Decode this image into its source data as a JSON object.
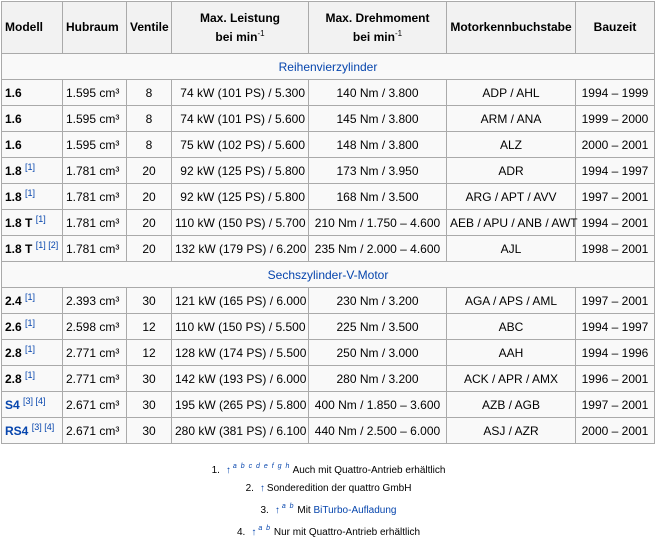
{
  "headers": {
    "modell": "Modell",
    "hubraum": "Hubraum",
    "ventile": "Ventile",
    "leistung_l1": "Max. Leistung",
    "leistung_l2": "bei min",
    "drehmoment_l1": "Max. Drehmoment",
    "drehmoment_l2": "bei min",
    "unit_exp": "-1",
    "mkb": "Motorkennbuchstabe",
    "bauzeit": "Bauzeit"
  },
  "groups": [
    {
      "title": "Reihenvierzylinder",
      "rows": [
        {
          "modell": "1.6",
          "link": false,
          "refs": "",
          "hubraum": "1.595 cm³",
          "ventile": "8",
          "leistung": "74 kW (101 PS) / 5.300",
          "drehmoment": "140 Nm / 3.800",
          "mkb": "ADP / AHL",
          "bauzeit": "1994 – 1999"
        },
        {
          "modell": "1.6",
          "link": false,
          "refs": "",
          "hubraum": "1.595 cm³",
          "ventile": "8",
          "leistung": "74 kW (101 PS) / 5.600",
          "drehmoment": "145 Nm / 3.800",
          "mkb": "ARM / ANA",
          "bauzeit": "1999 – 2000"
        },
        {
          "modell": "1.6",
          "link": false,
          "refs": "",
          "hubraum": "1.595 cm³",
          "ventile": "8",
          "leistung": "75 kW (102 PS) / 5.600",
          "drehmoment": "148 Nm / 3.800",
          "mkb": "ALZ",
          "bauzeit": "2000 – 2001"
        },
        {
          "modell": "1.8",
          "link": false,
          "refs": "[1]",
          "hubraum": "1.781 cm³",
          "ventile": "20",
          "leistung": "92 kW (125 PS) / 5.800",
          "drehmoment": "173 Nm / 3.950",
          "mkb": "ADR",
          "bauzeit": "1994 – 1997"
        },
        {
          "modell": "1.8",
          "link": false,
          "refs": "[1]",
          "hubraum": "1.781 cm³",
          "ventile": "20",
          "leistung": "92 kW (125 PS) / 5.800",
          "drehmoment": "168 Nm / 3.500",
          "mkb": "ARG / APT / AVV",
          "bauzeit": "1997 – 2001"
        },
        {
          "modell": "1.8 T",
          "link": false,
          "refs": "[1]",
          "hubraum": "1.781 cm³",
          "ventile": "20",
          "leistung": "110 kW (150 PS) / 5.700",
          "drehmoment": "210 Nm / 1.750 – 4.600",
          "mkb": "AEB / APU / ANB / AWT",
          "bauzeit": "1994 – 2001"
        },
        {
          "modell": "1.8 T",
          "link": false,
          "refs": "[1] [2]",
          "hubraum": "1.781 cm³",
          "ventile": "20",
          "leistung": "132 kW (179 PS) / 6.200",
          "drehmoment": "235 Nm / 2.000 – 4.600",
          "mkb": "AJL",
          "bauzeit": "1998 – 2001"
        }
      ]
    },
    {
      "title": "Sechszylinder-V-Motor",
      "rows": [
        {
          "modell": "2.4",
          "link": false,
          "refs": "[1]",
          "hubraum": "2.393 cm³",
          "ventile": "30",
          "leistung": "121 kW (165 PS) / 6.000",
          "drehmoment": "230 Nm / 3.200",
          "mkb": "AGA / APS / AML",
          "bauzeit": "1997 – 2001"
        },
        {
          "modell": "2.6",
          "link": false,
          "refs": "[1]",
          "hubraum": "2.598 cm³",
          "ventile": "12",
          "leistung": "110 kW (150 PS) / 5.500",
          "drehmoment": "225 Nm / 3.500",
          "mkb": "ABC",
          "bauzeit": "1994 – 1997"
        },
        {
          "modell": "2.8",
          "link": false,
          "refs": "[1]",
          "hubraum": "2.771 cm³",
          "ventile": "12",
          "leistung": "128 kW (174 PS) / 5.500",
          "drehmoment": "250 Nm / 3.000",
          "mkb": "AAH",
          "bauzeit": "1994 – 1996"
        },
        {
          "modell": "2.8",
          "link": false,
          "refs": "[1]",
          "hubraum": "2.771 cm³",
          "ventile": "30",
          "leistung": "142 kW (193 PS) / 6.000",
          "drehmoment": "280 Nm / 3.200",
          "mkb": "ACK / APR / AMX",
          "bauzeit": "1996 – 2001"
        },
        {
          "modell": "S4",
          "link": true,
          "refs": "[3] [4]",
          "hubraum": "2.671 cm³",
          "ventile": "30",
          "leistung": "195 kW (265 PS) / 5.800",
          "drehmoment": "400 Nm / 1.850 – 3.600",
          "mkb": "AZB / AGB",
          "bauzeit": "1997 – 2001"
        },
        {
          "modell": "RS4",
          "link": true,
          "refs": "[3] [4]",
          "hubraum": "2.671 cm³",
          "ventile": "30",
          "leistung": "280 kW (381 PS) / 6.100",
          "drehmoment": "440 Nm / 2.500 – 6.000",
          "mkb": "ASJ / AZR",
          "bauzeit": "2000 – 2001"
        }
      ]
    }
  ],
  "footnotes": [
    {
      "num": "1.",
      "arrow": "↑",
      "letters": "a b c d e f g h",
      "text": "Auch mit Quattro-Antrieb erhältlich",
      "link_text": ""
    },
    {
      "num": "2.",
      "arrow": "↑",
      "letters": "",
      "text": "Sonderedition der quattro GmbH",
      "link_text": ""
    },
    {
      "num": "3.",
      "arrow": "↑",
      "letters": "a b",
      "text": "Mit ",
      "link_text": "BiTurbo-Aufladung"
    },
    {
      "num": "4.",
      "arrow": "↑",
      "letters": "a b",
      "text": "Nur mit Quattro-Antrieb erhältlich",
      "link_text": ""
    }
  ],
  "colors": {
    "link": "#0645ad",
    "border": "#aaaaaa",
    "header_bg": "#f2f2f2",
    "cell_bg": "#f9f9f9"
  }
}
